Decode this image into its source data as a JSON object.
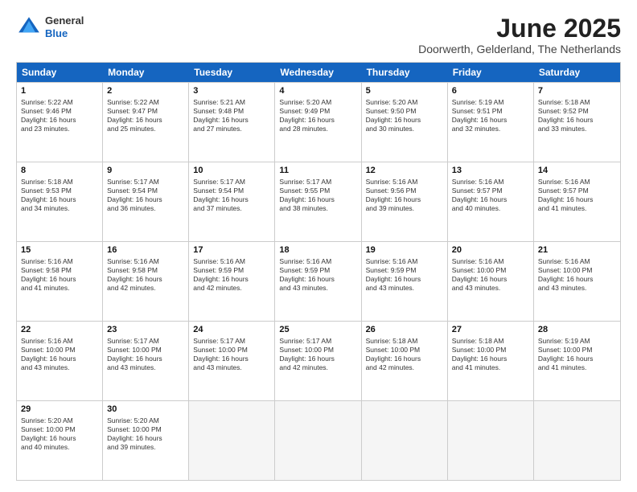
{
  "logo": {
    "line1": "General",
    "line2": "Blue"
  },
  "title": "June 2025",
  "location": "Doorwerth, Gelderland, The Netherlands",
  "header_days": [
    "Sunday",
    "Monday",
    "Tuesday",
    "Wednesday",
    "Thursday",
    "Friday",
    "Saturday"
  ],
  "weeks": [
    [
      {
        "day": "1",
        "lines": [
          "Sunrise: 5:22 AM",
          "Sunset: 9:46 PM",
          "Daylight: 16 hours",
          "and 23 minutes."
        ]
      },
      {
        "day": "2",
        "lines": [
          "Sunrise: 5:22 AM",
          "Sunset: 9:47 PM",
          "Daylight: 16 hours",
          "and 25 minutes."
        ]
      },
      {
        "day": "3",
        "lines": [
          "Sunrise: 5:21 AM",
          "Sunset: 9:48 PM",
          "Daylight: 16 hours",
          "and 27 minutes."
        ]
      },
      {
        "day": "4",
        "lines": [
          "Sunrise: 5:20 AM",
          "Sunset: 9:49 PM",
          "Daylight: 16 hours",
          "and 28 minutes."
        ]
      },
      {
        "day": "5",
        "lines": [
          "Sunrise: 5:20 AM",
          "Sunset: 9:50 PM",
          "Daylight: 16 hours",
          "and 30 minutes."
        ]
      },
      {
        "day": "6",
        "lines": [
          "Sunrise: 5:19 AM",
          "Sunset: 9:51 PM",
          "Daylight: 16 hours",
          "and 32 minutes."
        ]
      },
      {
        "day": "7",
        "lines": [
          "Sunrise: 5:18 AM",
          "Sunset: 9:52 PM",
          "Daylight: 16 hours",
          "and 33 minutes."
        ]
      }
    ],
    [
      {
        "day": "8",
        "lines": [
          "Sunrise: 5:18 AM",
          "Sunset: 9:53 PM",
          "Daylight: 16 hours",
          "and 34 minutes."
        ]
      },
      {
        "day": "9",
        "lines": [
          "Sunrise: 5:17 AM",
          "Sunset: 9:54 PM",
          "Daylight: 16 hours",
          "and 36 minutes."
        ]
      },
      {
        "day": "10",
        "lines": [
          "Sunrise: 5:17 AM",
          "Sunset: 9:54 PM",
          "Daylight: 16 hours",
          "and 37 minutes."
        ]
      },
      {
        "day": "11",
        "lines": [
          "Sunrise: 5:17 AM",
          "Sunset: 9:55 PM",
          "Daylight: 16 hours",
          "and 38 minutes."
        ]
      },
      {
        "day": "12",
        "lines": [
          "Sunrise: 5:16 AM",
          "Sunset: 9:56 PM",
          "Daylight: 16 hours",
          "and 39 minutes."
        ]
      },
      {
        "day": "13",
        "lines": [
          "Sunrise: 5:16 AM",
          "Sunset: 9:57 PM",
          "Daylight: 16 hours",
          "and 40 minutes."
        ]
      },
      {
        "day": "14",
        "lines": [
          "Sunrise: 5:16 AM",
          "Sunset: 9:57 PM",
          "Daylight: 16 hours",
          "and 41 minutes."
        ]
      }
    ],
    [
      {
        "day": "15",
        "lines": [
          "Sunrise: 5:16 AM",
          "Sunset: 9:58 PM",
          "Daylight: 16 hours",
          "and 41 minutes."
        ]
      },
      {
        "day": "16",
        "lines": [
          "Sunrise: 5:16 AM",
          "Sunset: 9:58 PM",
          "Daylight: 16 hours",
          "and 42 minutes."
        ]
      },
      {
        "day": "17",
        "lines": [
          "Sunrise: 5:16 AM",
          "Sunset: 9:59 PM",
          "Daylight: 16 hours",
          "and 42 minutes."
        ]
      },
      {
        "day": "18",
        "lines": [
          "Sunrise: 5:16 AM",
          "Sunset: 9:59 PM",
          "Daylight: 16 hours",
          "and 43 minutes."
        ]
      },
      {
        "day": "19",
        "lines": [
          "Sunrise: 5:16 AM",
          "Sunset: 9:59 PM",
          "Daylight: 16 hours",
          "and 43 minutes."
        ]
      },
      {
        "day": "20",
        "lines": [
          "Sunrise: 5:16 AM",
          "Sunset: 10:00 PM",
          "Daylight: 16 hours",
          "and 43 minutes."
        ]
      },
      {
        "day": "21",
        "lines": [
          "Sunrise: 5:16 AM",
          "Sunset: 10:00 PM",
          "Daylight: 16 hours",
          "and 43 minutes."
        ]
      }
    ],
    [
      {
        "day": "22",
        "lines": [
          "Sunrise: 5:16 AM",
          "Sunset: 10:00 PM",
          "Daylight: 16 hours",
          "and 43 minutes."
        ]
      },
      {
        "day": "23",
        "lines": [
          "Sunrise: 5:17 AM",
          "Sunset: 10:00 PM",
          "Daylight: 16 hours",
          "and 43 minutes."
        ]
      },
      {
        "day": "24",
        "lines": [
          "Sunrise: 5:17 AM",
          "Sunset: 10:00 PM",
          "Daylight: 16 hours",
          "and 43 minutes."
        ]
      },
      {
        "day": "25",
        "lines": [
          "Sunrise: 5:17 AM",
          "Sunset: 10:00 PM",
          "Daylight: 16 hours",
          "and 42 minutes."
        ]
      },
      {
        "day": "26",
        "lines": [
          "Sunrise: 5:18 AM",
          "Sunset: 10:00 PM",
          "Daylight: 16 hours",
          "and 42 minutes."
        ]
      },
      {
        "day": "27",
        "lines": [
          "Sunrise: 5:18 AM",
          "Sunset: 10:00 PM",
          "Daylight: 16 hours",
          "and 41 minutes."
        ]
      },
      {
        "day": "28",
        "lines": [
          "Sunrise: 5:19 AM",
          "Sunset: 10:00 PM",
          "Daylight: 16 hours",
          "and 41 minutes."
        ]
      }
    ],
    [
      {
        "day": "29",
        "lines": [
          "Sunrise: 5:20 AM",
          "Sunset: 10:00 PM",
          "Daylight: 16 hours",
          "and 40 minutes."
        ]
      },
      {
        "day": "30",
        "lines": [
          "Sunrise: 5:20 AM",
          "Sunset: 10:00 PM",
          "Daylight: 16 hours",
          "and 39 minutes."
        ]
      },
      {
        "day": "",
        "lines": []
      },
      {
        "day": "",
        "lines": []
      },
      {
        "day": "",
        "lines": []
      },
      {
        "day": "",
        "lines": []
      },
      {
        "day": "",
        "lines": []
      }
    ]
  ]
}
